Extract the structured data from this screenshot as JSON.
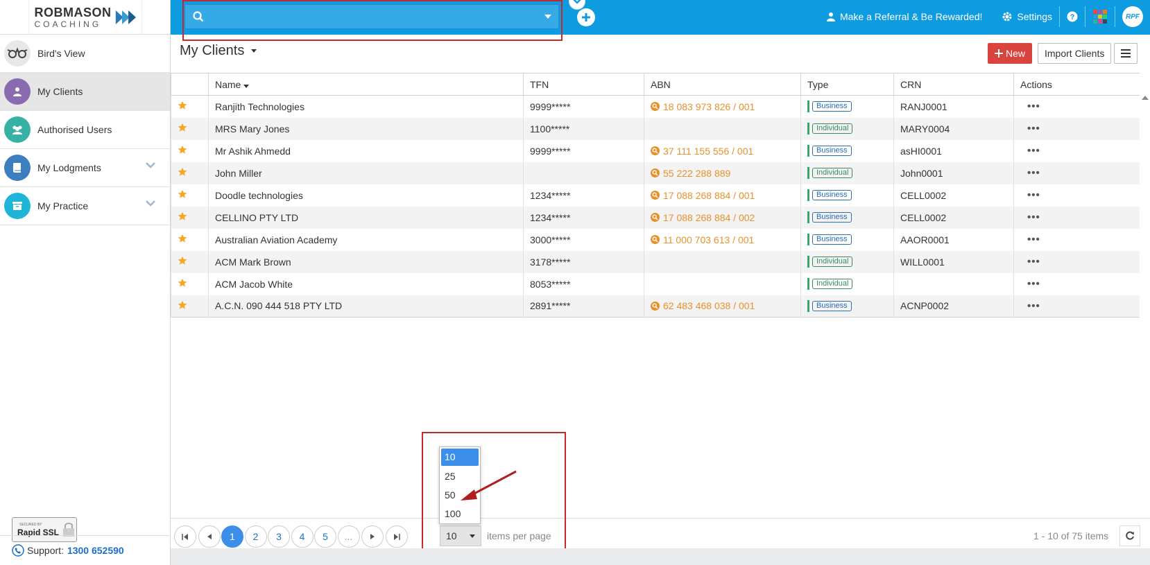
{
  "logo": {
    "line1": "ROBMASON",
    "line2": "COACHING"
  },
  "sidebar": {
    "items": [
      {
        "label": "Bird's View",
        "icon": "birds-view-icon",
        "color": "#8a8a8a"
      },
      {
        "label": "My Clients",
        "icon": "user-icon",
        "color": "#8a6bb0",
        "active": true
      },
      {
        "label": "Authorised Users",
        "icon": "users-icon",
        "color": "#35b2a3"
      },
      {
        "label": "My Lodgments",
        "icon": "book-icon",
        "color": "#3d7ec0",
        "expandable": true
      },
      {
        "label": "My Practice",
        "icon": "archive-icon",
        "color": "#1fb5d8",
        "expandable": true
      }
    ],
    "ssl": {
      "small": "SECURED BY",
      "big": "Rapid SSL"
    },
    "support": {
      "label": "Support:",
      "number": "1300 652590"
    }
  },
  "topbar": {
    "search": {
      "value": "",
      "placeholder": ""
    },
    "referral": "Make a Referral & Be Rewarded!",
    "settings": "Settings",
    "help_icon": "question-circle-icon",
    "apps_icon": "apps-grid-icon",
    "brand": "RPF"
  },
  "page": {
    "title": "My Clients",
    "new_label": "New",
    "import_label": "Import Clients"
  },
  "table": {
    "headers": {
      "name": "Name",
      "tfn": "TFN",
      "abn": "ABN",
      "type": "Type",
      "crn": "CRN",
      "actions": "Actions"
    },
    "rows": [
      {
        "name": "Ranjith Technologies",
        "tfn": "9999*****",
        "abn": "18 083 973 826 / 001",
        "type": "Business",
        "crn": "RANJ0001"
      },
      {
        "name": "MRS Mary Jones",
        "tfn": "1100*****",
        "abn": "",
        "type": "Individual",
        "crn": "MARY0004"
      },
      {
        "name": "Mr Ashik Ahmedd",
        "tfn": "9999*****",
        "abn": "37 111 155 556 / 001",
        "type": "Business",
        "crn": "asHI0001"
      },
      {
        "name": "John Miller",
        "tfn": "",
        "abn": "55 222 288 889",
        "type": "Individual",
        "crn": "John0001"
      },
      {
        "name": "Doodle technologies",
        "tfn": "1234*****",
        "abn": "17 088 268 884 / 001",
        "type": "Business",
        "crn": "CELL0002"
      },
      {
        "name": "CELLINO PTY LTD",
        "tfn": "1234*****",
        "abn": "17 088 268 884 / 002",
        "type": "Business",
        "crn": "CELL0002"
      },
      {
        "name": "Australian Aviation Academy",
        "tfn": "3000*****",
        "abn": "11 000 703 613 / 001",
        "type": "Business",
        "crn": "AAOR0001"
      },
      {
        "name": "ACM Mark Brown",
        "tfn": "3178*****",
        "abn": "",
        "type": "Individual",
        "crn": "WILL0001"
      },
      {
        "name": "ACM Jacob White",
        "tfn": "8053*****",
        "abn": "",
        "type": "Individual",
        "crn": ""
      },
      {
        "name": "A.C.N. 090 444 518 PTY LTD",
        "tfn": "2891*****",
        "abn": "62 483 468 038 / 001",
        "type": "Business",
        "crn": "ACNP0002"
      }
    ]
  },
  "pager": {
    "pages": [
      "1",
      "2",
      "3",
      "4",
      "5",
      "..."
    ],
    "current": "1",
    "per_page": "10",
    "per_page_options": [
      "10",
      "25",
      "50",
      "100"
    ],
    "per_page_label": "items per page",
    "range": "1 - 10 of 75 items"
  },
  "colors": {
    "topbar": "#0f9be0",
    "accent": "#3c8ee8",
    "new_button": "#d9443e",
    "abn": "#e8912a",
    "highlight": "#c9272d"
  }
}
